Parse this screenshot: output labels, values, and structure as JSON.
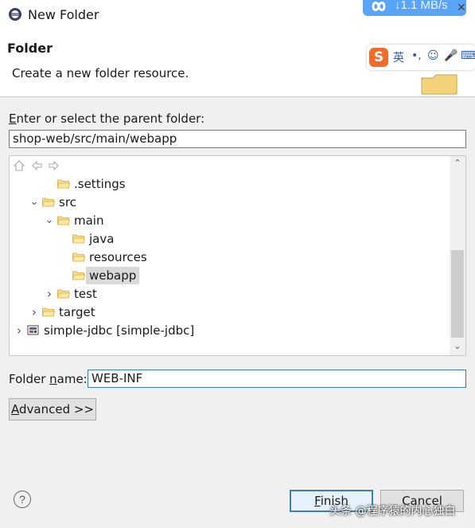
{
  "window": {
    "title": "New Folder",
    "speed_widget_text": "↓1.1 MB/s"
  },
  "header": {
    "title": "Folder",
    "description": "Create a new folder resource."
  },
  "ime_toolbar": {
    "logo": "S",
    "items": [
      "英",
      "•,",
      "☺",
      "🎤",
      "⌨"
    ]
  },
  "parent_folder": {
    "label_prefix": "E",
    "label_rest": "nter or select the parent folder:",
    "value": "shop-web/src/main/webapp"
  },
  "tree": {
    "nodes": [
      {
        "label": ".settings",
        "level": 2,
        "chevron": "",
        "icon": "folder-icon"
      },
      {
        "label": "src",
        "level": 1,
        "chevron": "open",
        "icon": "folder-icon"
      },
      {
        "label": "main",
        "level": 2,
        "chevron": "open",
        "icon": "folder-icon"
      },
      {
        "label": "java",
        "level": 3,
        "chevron": "",
        "icon": "folder-icon"
      },
      {
        "label": "resources",
        "level": 3,
        "chevron": "",
        "icon": "folder-icon"
      },
      {
        "label": "webapp",
        "level": 3,
        "chevron": "",
        "icon": "folder-icon",
        "selected": true
      },
      {
        "label": "test",
        "level": 2,
        "chevron": "closed",
        "icon": "folder-icon"
      },
      {
        "label": "target",
        "level": 1,
        "chevron": "closed",
        "icon": "folder-icon"
      },
      {
        "label": "simple-jdbc [simple-jdbc]",
        "level": 0,
        "chevron": "closed",
        "icon": "project-icon"
      }
    ]
  },
  "folder_name": {
    "label_pre": "Folder ",
    "label_mnemonic": "n",
    "label_post": "ame:",
    "value": "WEB-INF"
  },
  "buttons": {
    "advanced_mnemonic": "A",
    "advanced_rest": "dvanced >>",
    "finish_mnemonic": "F",
    "finish_rest": "inish",
    "cancel": "Cancel"
  },
  "help": "?",
  "watermark": "头条 @程序猿的内心独白",
  "colors": {
    "accent": "#3c7fb1",
    "folder": "#e8b84a",
    "speed_widget": "#5aa4f5",
    "ime_logo": "#f26b2a"
  }
}
